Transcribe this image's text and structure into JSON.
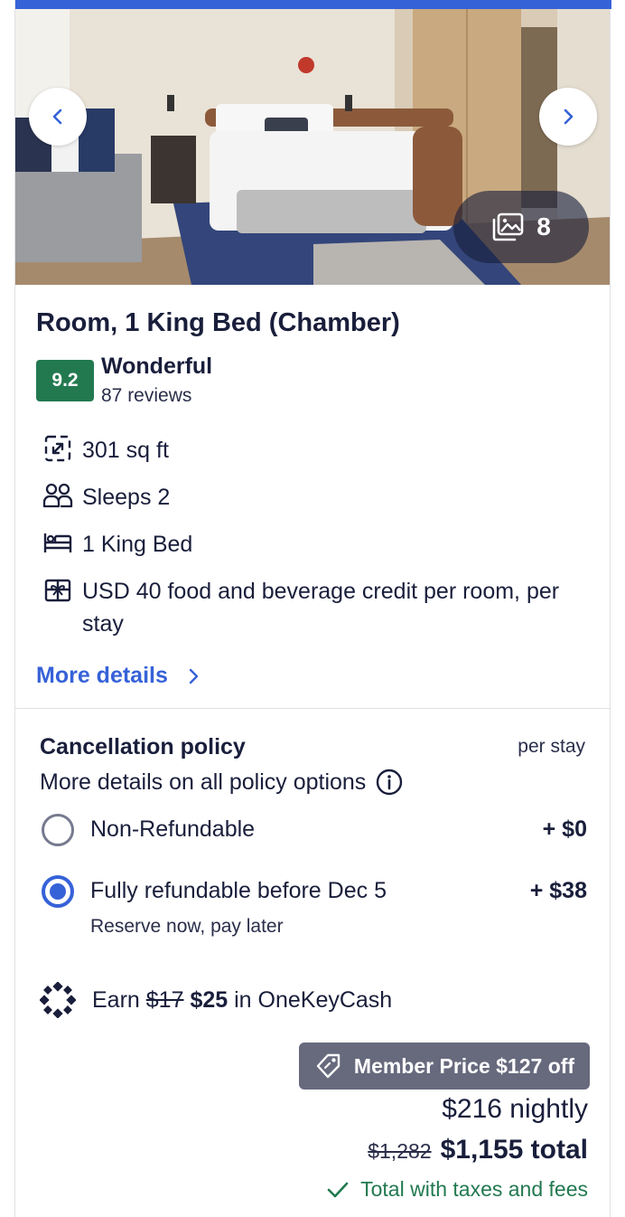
{
  "gallery": {
    "photo_count": "8"
  },
  "room": {
    "title": "Room, 1 King Bed (Chamber)",
    "score": "9.2",
    "score_label": "Wonderful",
    "reviews": "87 reviews",
    "features": [
      {
        "icon": "expand-arrows-icon",
        "text": "301 sq ft"
      },
      {
        "icon": "people-icon",
        "text": "Sleeps 2"
      },
      {
        "icon": "bed-icon",
        "text": "1 King Bed"
      },
      {
        "icon": "gift-icon",
        "text": "USD 40 food and beverage credit per room, per stay"
      }
    ],
    "more_details": "More details"
  },
  "policy": {
    "title": "Cancellation policy",
    "per_stay": "per stay",
    "more_options": "More details on all policy options",
    "options": [
      {
        "label": "Non-Refundable",
        "price": "+ $0",
        "selected": false
      },
      {
        "label": "Fully refundable before Dec 5",
        "price": "+ $38",
        "sub": "Reserve now, pay later",
        "selected": true
      }
    ]
  },
  "earn": {
    "prefix": "Earn",
    "old": "$17",
    "new": "$25",
    "suffix": "in OneKeyCash"
  },
  "price": {
    "member_badge": "Member Price $127 off",
    "nightly": "$216 nightly",
    "old_total": "$1,282",
    "new_total": "$1,155 total",
    "taxes_note": "Total with taxes and fees"
  },
  "colors": {
    "accent": "#3662d8",
    "score_green": "#227950",
    "member_badge": "#676a7d"
  }
}
